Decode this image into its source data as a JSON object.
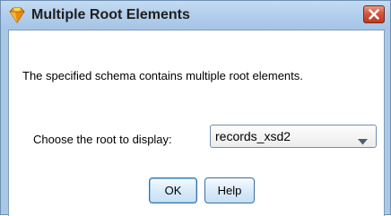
{
  "dialog": {
    "title": "Multiple Root Elements",
    "close_label": "Close"
  },
  "colors": {
    "titlebar": "#b3cfec",
    "close_button": "#d4553a",
    "button_border": "#3c6e9f"
  },
  "icons": {
    "app": "gem-icon",
    "close": "close-icon",
    "dropdown": "chevron-down-icon"
  },
  "body": {
    "message": "The specified schema contains multiple root elements.",
    "root_label": "Choose the root to display:",
    "root_select_value": "records_xsd2"
  },
  "buttons": {
    "ok_label": "OK",
    "help_label": "Help"
  }
}
